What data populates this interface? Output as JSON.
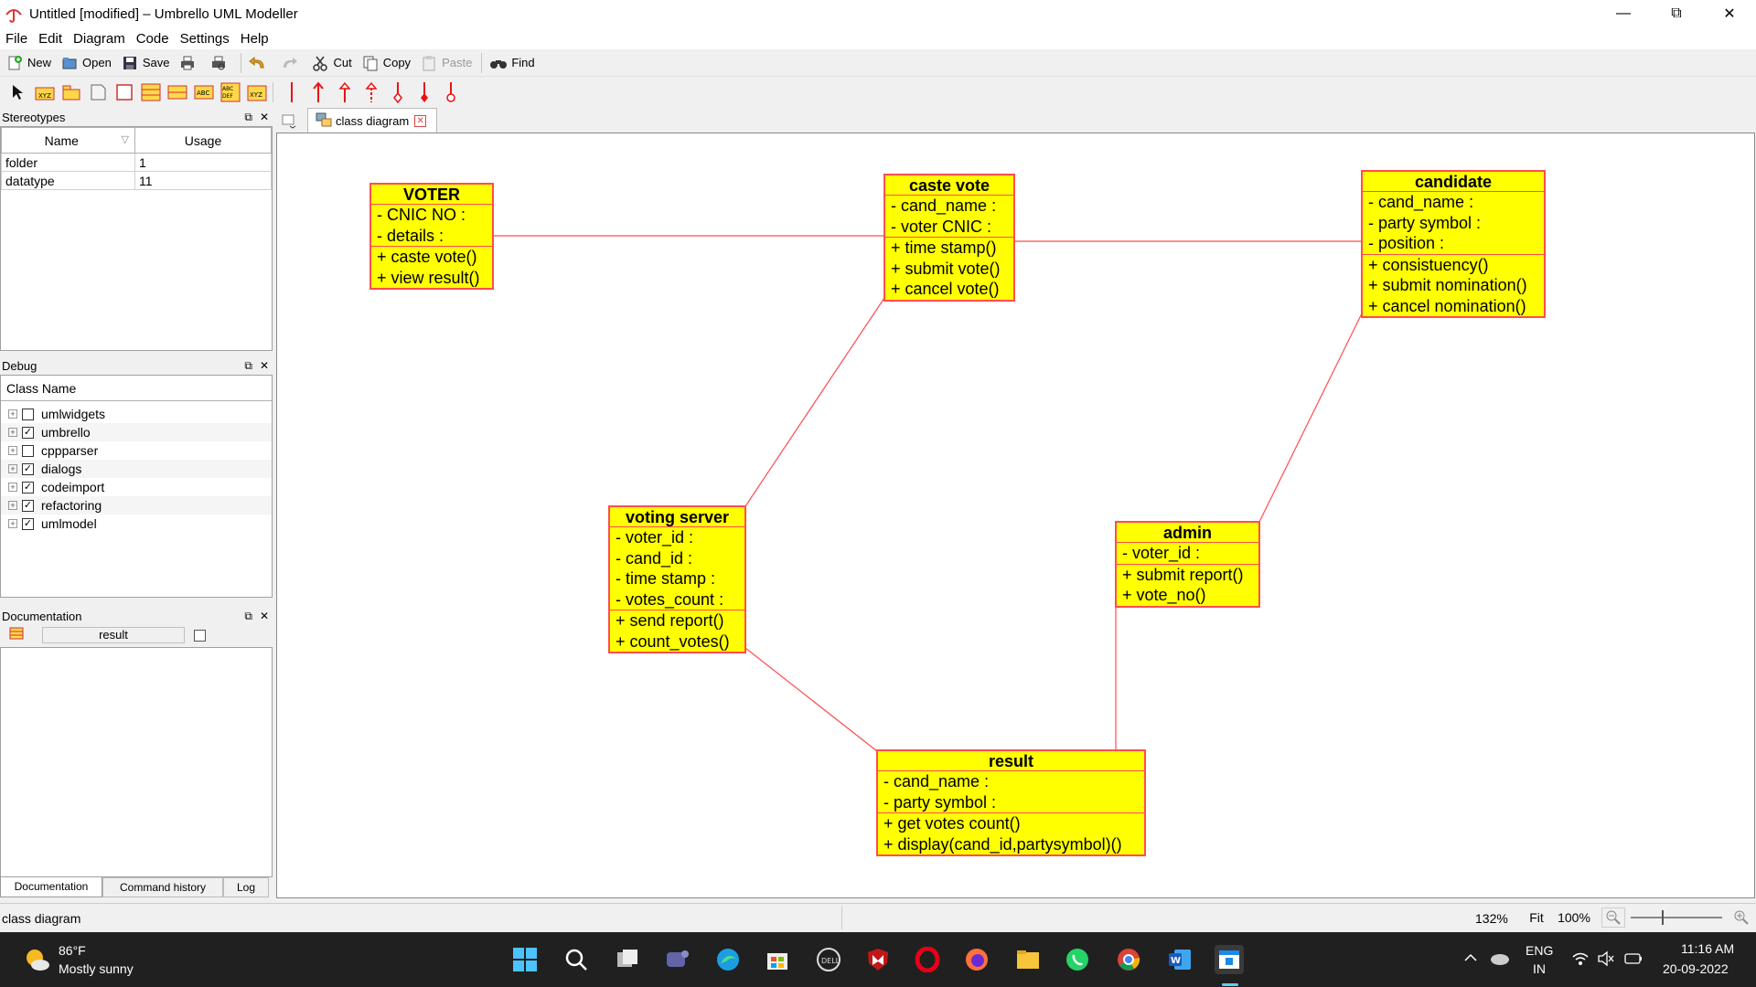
{
  "window": {
    "title": "Untitled [modified] – Umbrello UML Modeller"
  },
  "menu": [
    "File",
    "Edit",
    "Diagram",
    "Code",
    "Settings",
    "Help"
  ],
  "toolbar": {
    "new": "New",
    "open": "Open",
    "save": "Save",
    "cut": "Cut",
    "copy": "Copy",
    "paste": "Paste",
    "find": "Find"
  },
  "stereotypes": {
    "title": "Stereotypes",
    "col_name": "Name",
    "col_usage": "Usage",
    "rows": [
      {
        "name": "folder",
        "usage": "1"
      },
      {
        "name": "datatype",
        "usage": "11"
      }
    ]
  },
  "debug": {
    "title": "Debug",
    "header": "Class Name",
    "items": [
      {
        "label": "umlwidgets",
        "checked": false
      },
      {
        "label": "umbrello",
        "checked": true
      },
      {
        "label": "cppparser",
        "checked": false
      },
      {
        "label": "dialogs",
        "checked": true
      },
      {
        "label": "codeimport",
        "checked": true
      },
      {
        "label": "refactoring",
        "checked": true
      },
      {
        "label": "umlmodel",
        "checked": true
      }
    ]
  },
  "documentation": {
    "title": "Documentation",
    "field": "result",
    "tabs": [
      "Documentation",
      "Command history",
      "Log"
    ]
  },
  "diagram_tab": "class diagram",
  "classes": {
    "voter": {
      "name": "VOTER",
      "attrs": [
        "- CNIC NO :",
        "- details :"
      ],
      "ops": [
        "+ caste vote()",
        "+ view result()"
      ]
    },
    "caste_vote": {
      "name": "caste vote",
      "attrs": [
        "- cand_name :",
        "- voter CNIC :"
      ],
      "ops": [
        "+ time stamp()",
        "+ submit vote()",
        "+ cancel vote()"
      ]
    },
    "candidate": {
      "name": "candidate",
      "attrs": [
        "- cand_name :",
        "- party symbol :",
        "- position :"
      ],
      "ops": [
        "+ consistuency()",
        "+ submit nomination()",
        "+ cancel nomination()"
      ]
    },
    "voting_server": {
      "name": "voting server",
      "attrs": [
        "- voter_id :",
        "- cand_id :",
        "- time stamp :",
        "- votes_count :"
      ],
      "ops": [
        "+ send report()",
        "+ count_votes()"
      ]
    },
    "admin": {
      "name": "admin",
      "attrs": [
        "- voter_id :"
      ],
      "ops": [
        "+ submit report()",
        "+ vote_no()"
      ]
    },
    "result": {
      "name": "result",
      "attrs": [
        "- cand_name :",
        "- party symbol :"
      ],
      "ops": [
        "+ get votes count()",
        "+ display(cand_id,partysymbol)()"
      ]
    }
  },
  "statusbar": {
    "left": "class diagram",
    "zoom": "132%",
    "fit": "Fit",
    "hundred": "100%"
  },
  "taskbar": {
    "temp": "86°F",
    "weather": "Mostly sunny",
    "lang1": "ENG",
    "lang2": "IN",
    "time": "11:16 AM",
    "date": "20-09-2022"
  },
  "colors": {
    "class_fill": "#ffff00",
    "class_border": "#ff4d4d",
    "association": "#ff4d4d"
  }
}
